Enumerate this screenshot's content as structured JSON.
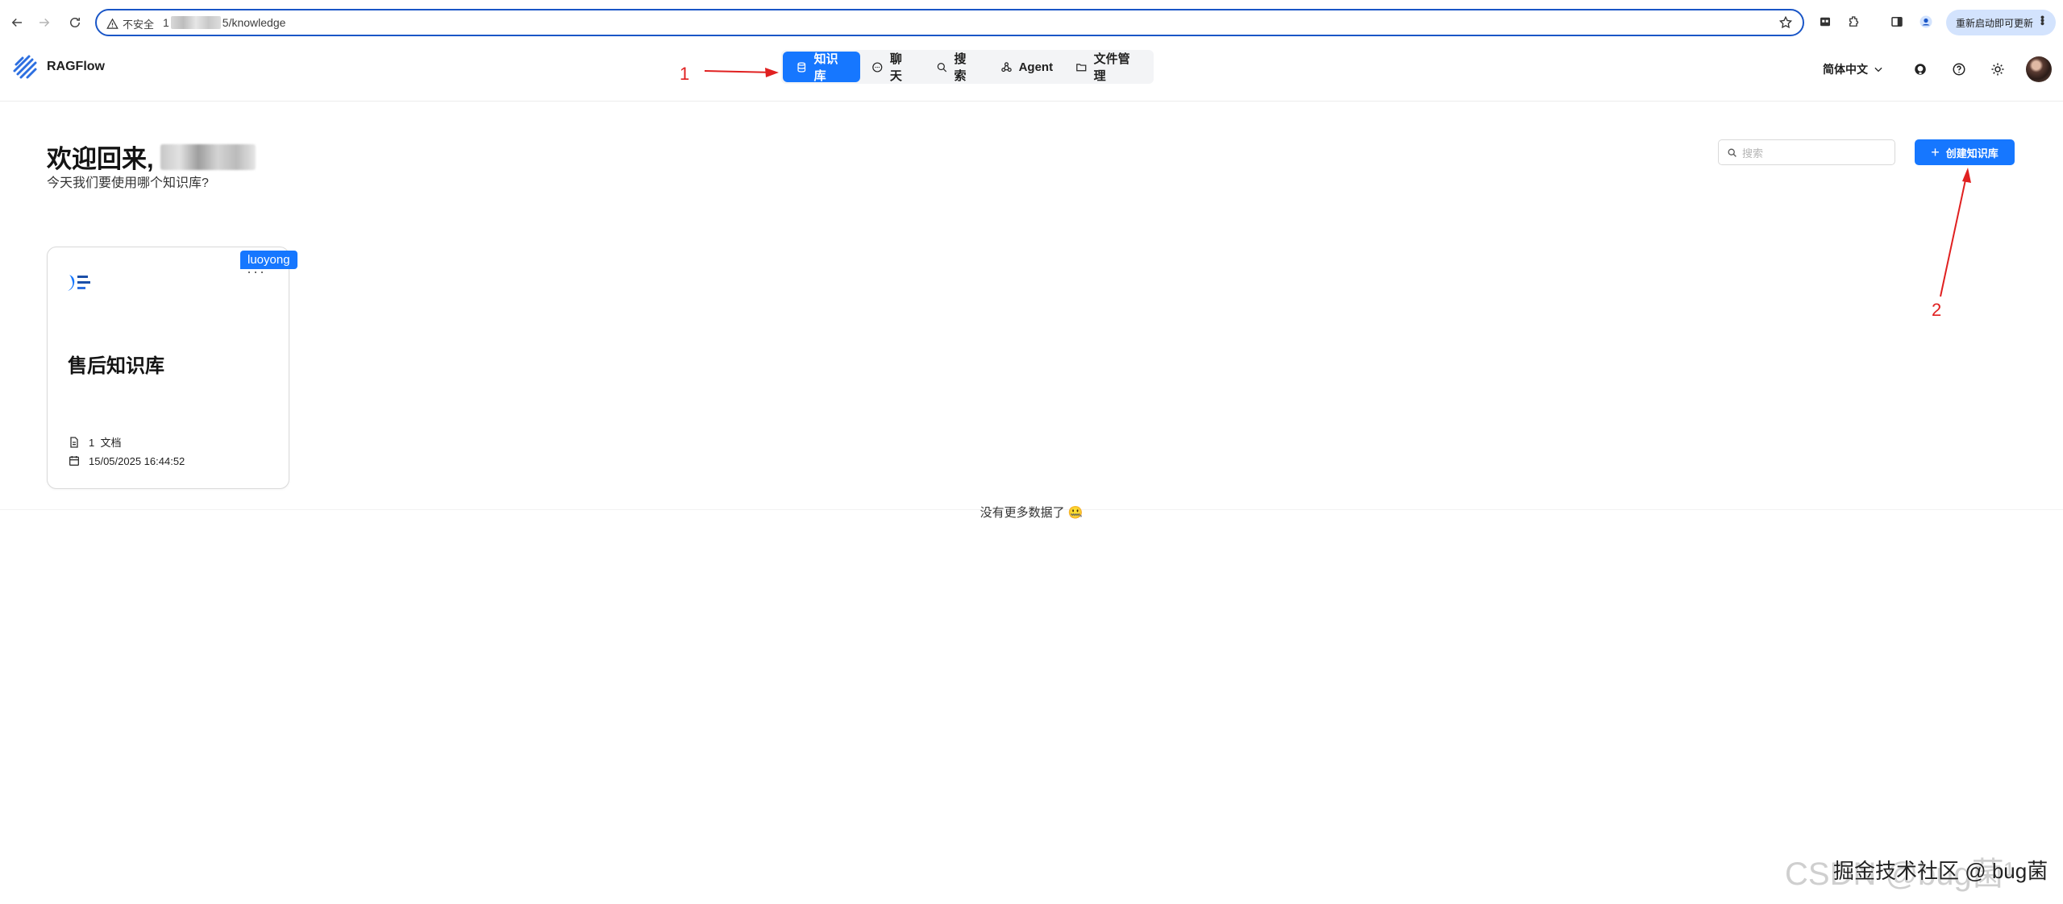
{
  "browser": {
    "security_label": "不安全",
    "url_prefix": "1",
    "url_suffix": "5/knowledge",
    "update_label": "重新启动即可更新"
  },
  "app": {
    "name": "RAGFlow",
    "nav": [
      {
        "label": "知识库",
        "icon": "database-icon",
        "active": true
      },
      {
        "label": "聊天",
        "icon": "chat-icon"
      },
      {
        "label": "搜索",
        "icon": "search-icon"
      },
      {
        "label": "Agent",
        "icon": "agent-icon"
      },
      {
        "label": "文件管理",
        "icon": "folder-icon"
      }
    ],
    "language": "简体中文"
  },
  "page": {
    "welcome": "欢迎回来, ",
    "subtitle": "今天我们要使用哪个知识库?",
    "search_placeholder": "搜索",
    "create_label": "创建知识库",
    "no_more": "没有更多数据了 🤐"
  },
  "knowledge_bases": [
    {
      "owner": "luoyong",
      "title": "售后知识库",
      "doc_count": "1",
      "doc_unit": "文档",
      "date": "15/05/2025 16:44:52"
    }
  ],
  "annotations": [
    "1",
    "2"
  ],
  "watermark": {
    "faint": "CSDN @bug菌¹",
    "text": "掘金技术社区 @ bug菌"
  },
  "colors": {
    "primary": "#1677ff",
    "annotation": "#e02020"
  }
}
